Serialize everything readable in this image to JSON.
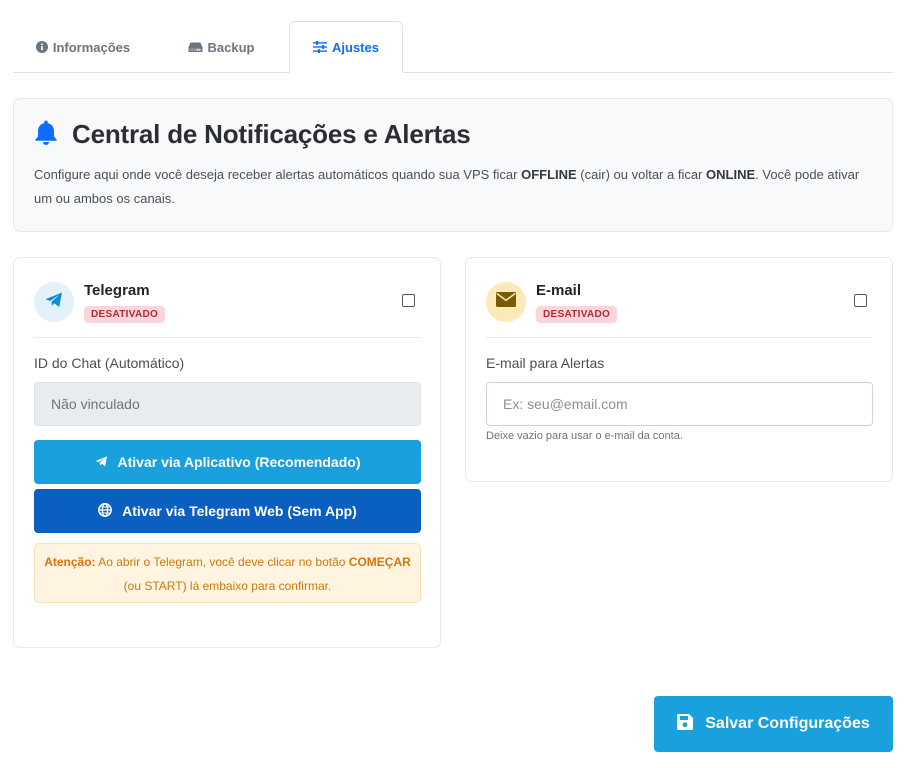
{
  "tabs": [
    {
      "label": "Informações",
      "icon": "info-circle-icon",
      "active": false
    },
    {
      "label": "Backup",
      "icon": "hdd-icon",
      "active": false
    },
    {
      "label": "Ajustes",
      "icon": "sliders-icon",
      "active": true
    }
  ],
  "info": {
    "icon": "bell-icon",
    "title": "Central de Notificações e Alertas",
    "desc_1": "Configure aqui onde você deseja receber alertas automáticos quando sua VPS ficar ",
    "desc_offline": "OFFLINE",
    "desc_2": " (cair) ou voltar a ficar ",
    "desc_online": "ONLINE",
    "desc_3": ". Você pode ativar um ou ambos os canais."
  },
  "telegram": {
    "icon": "paper-plane-icon",
    "title": "Telegram",
    "status": "DESATIVADO",
    "enabled": false,
    "field_label": "ID do Chat (Automático)",
    "field_placeholder": "Não vinculado",
    "btn_app": "Ativar via Aplicativo (Recomendado)",
    "btn_web": "Ativar via Telegram Web (Sem App)",
    "warn_label": "Atenção:",
    "warn_1": " Ao abrir o Telegram, você deve clicar no botão ",
    "warn_cta": "COMEÇAR",
    "warn_2": "(ou START) lá embaixo para confirmar."
  },
  "email": {
    "icon": "envelope-icon",
    "title": "E-mail",
    "status": "DESATIVADO",
    "enabled": false,
    "field_label": "E-mail para Alertas",
    "field_placeholder": "Ex: seu@email.com",
    "hint": "Deixe vazio para usar o e-mail da conta."
  },
  "save_label": "Salvar Configurações",
  "colors": {
    "primary": "#1aa0dd",
    "dark_blue": "#0a5fc0",
    "active_tab": "#0d6efd",
    "badge_bg": "#f8d7da",
    "badge_text": "#b02a37",
    "warning": "#d9730d"
  }
}
